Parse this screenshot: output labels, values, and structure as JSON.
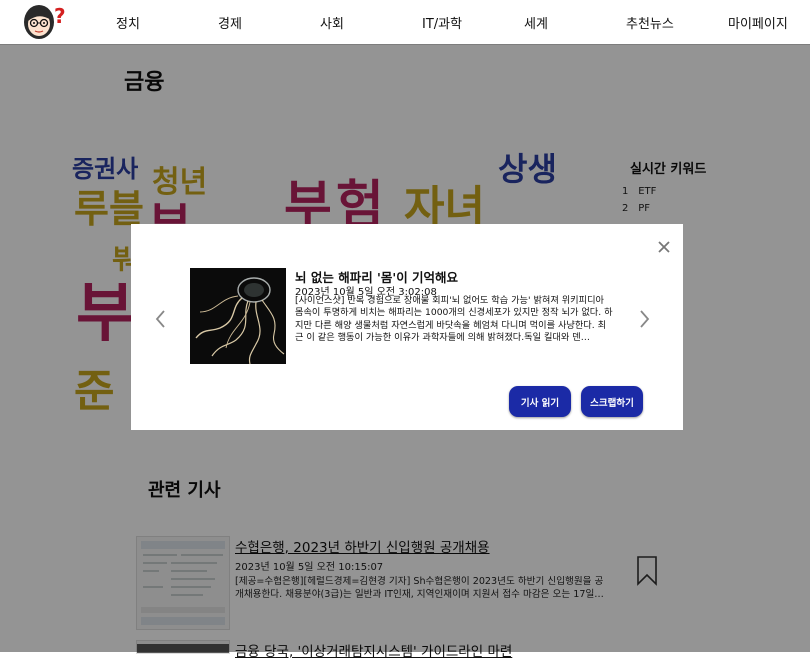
{
  "nav": {
    "items": [
      "정치",
      "경제",
      "사회",
      "IT/과학",
      "세계",
      "추천뉴스",
      "마이페이지"
    ],
    "logo_badge": "?"
  },
  "page": {
    "title": "금융"
  },
  "word_cloud": {
    "words": [
      {
        "text": "증권사",
        "color": "#2b3ea3"
      },
      {
        "text": "청년",
        "color": "#c7a51e"
      },
      {
        "text": "루블",
        "color": "#c7a51e"
      },
      {
        "text": "부",
        "color": "#b6235f"
      },
      {
        "text": "부",
        "color": "#b6235f"
      },
      {
        "text": "험",
        "color": "#b6235f"
      },
      {
        "text": "자녀",
        "color": "#c7a51e"
      },
      {
        "text": "상생",
        "color": "#2b3ea3"
      },
      {
        "text": "붜",
        "color": "#c7a51e"
      },
      {
        "text": "준",
        "color": "#c7a51e"
      }
    ]
  },
  "keywords": {
    "title": "실시간 키워드",
    "items": [
      {
        "rank": "1",
        "label": "ETF"
      },
      {
        "rank": "2",
        "label": "PF"
      }
    ]
  },
  "related": {
    "title": "관련 기사",
    "articles": [
      {
        "title": "수협은행, 2023년 하반기 신입행원 공개채용",
        "date": "2023년 10월 5일 오전 10:15:07",
        "summary": "[제공=수협은행][헤럴드경제=김현경 기자] Sh수협은행이 2023년도 하반기 신입행원을 공개채용한다. 채용분야(3급)는 일반과 IT인재, 지역인재이며 지원서 접수 마감은 오는 17일…"
      },
      {
        "title": "금융 당국, '이상거래탐지시스템' 가이드라인 마련",
        "date": "",
        "summary": ""
      }
    ]
  },
  "modal": {
    "title": "뇌 없는 해파리 '몸'이 기억해요",
    "date": "2023년 10월 5일 오전 3:02:08",
    "text": "[사이언스샷] 반복 경험으로 장애물 회피'뇌 없어도 학습 가능' 밝혀져 위키피디아 몸속이 투명하게 비치는 해파리는 1000개의 신경세포가 있지만 정작 뇌가 없다. 하지만 다른 해양 생물처럼 자연스럽게 바닷속을 헤엄쳐 다니며 먹이를 사냥한다. 최근 이 같은 행동이 가능한 이유가 과학자들에 의해 밝혀졌다.독일 킬대와 덴…",
    "read_button": "기사 읽기",
    "scrap_button": "스크랩하기"
  },
  "colors": {
    "accent": "#1b2aa6",
    "cloud_blue": "#2b3ea3",
    "cloud_yellow": "#c7a51e",
    "cloud_red": "#b6235f"
  },
  "icons": [
    "close-icon",
    "chevron-left-icon",
    "chevron-right-icon",
    "bookmark-icon"
  ]
}
